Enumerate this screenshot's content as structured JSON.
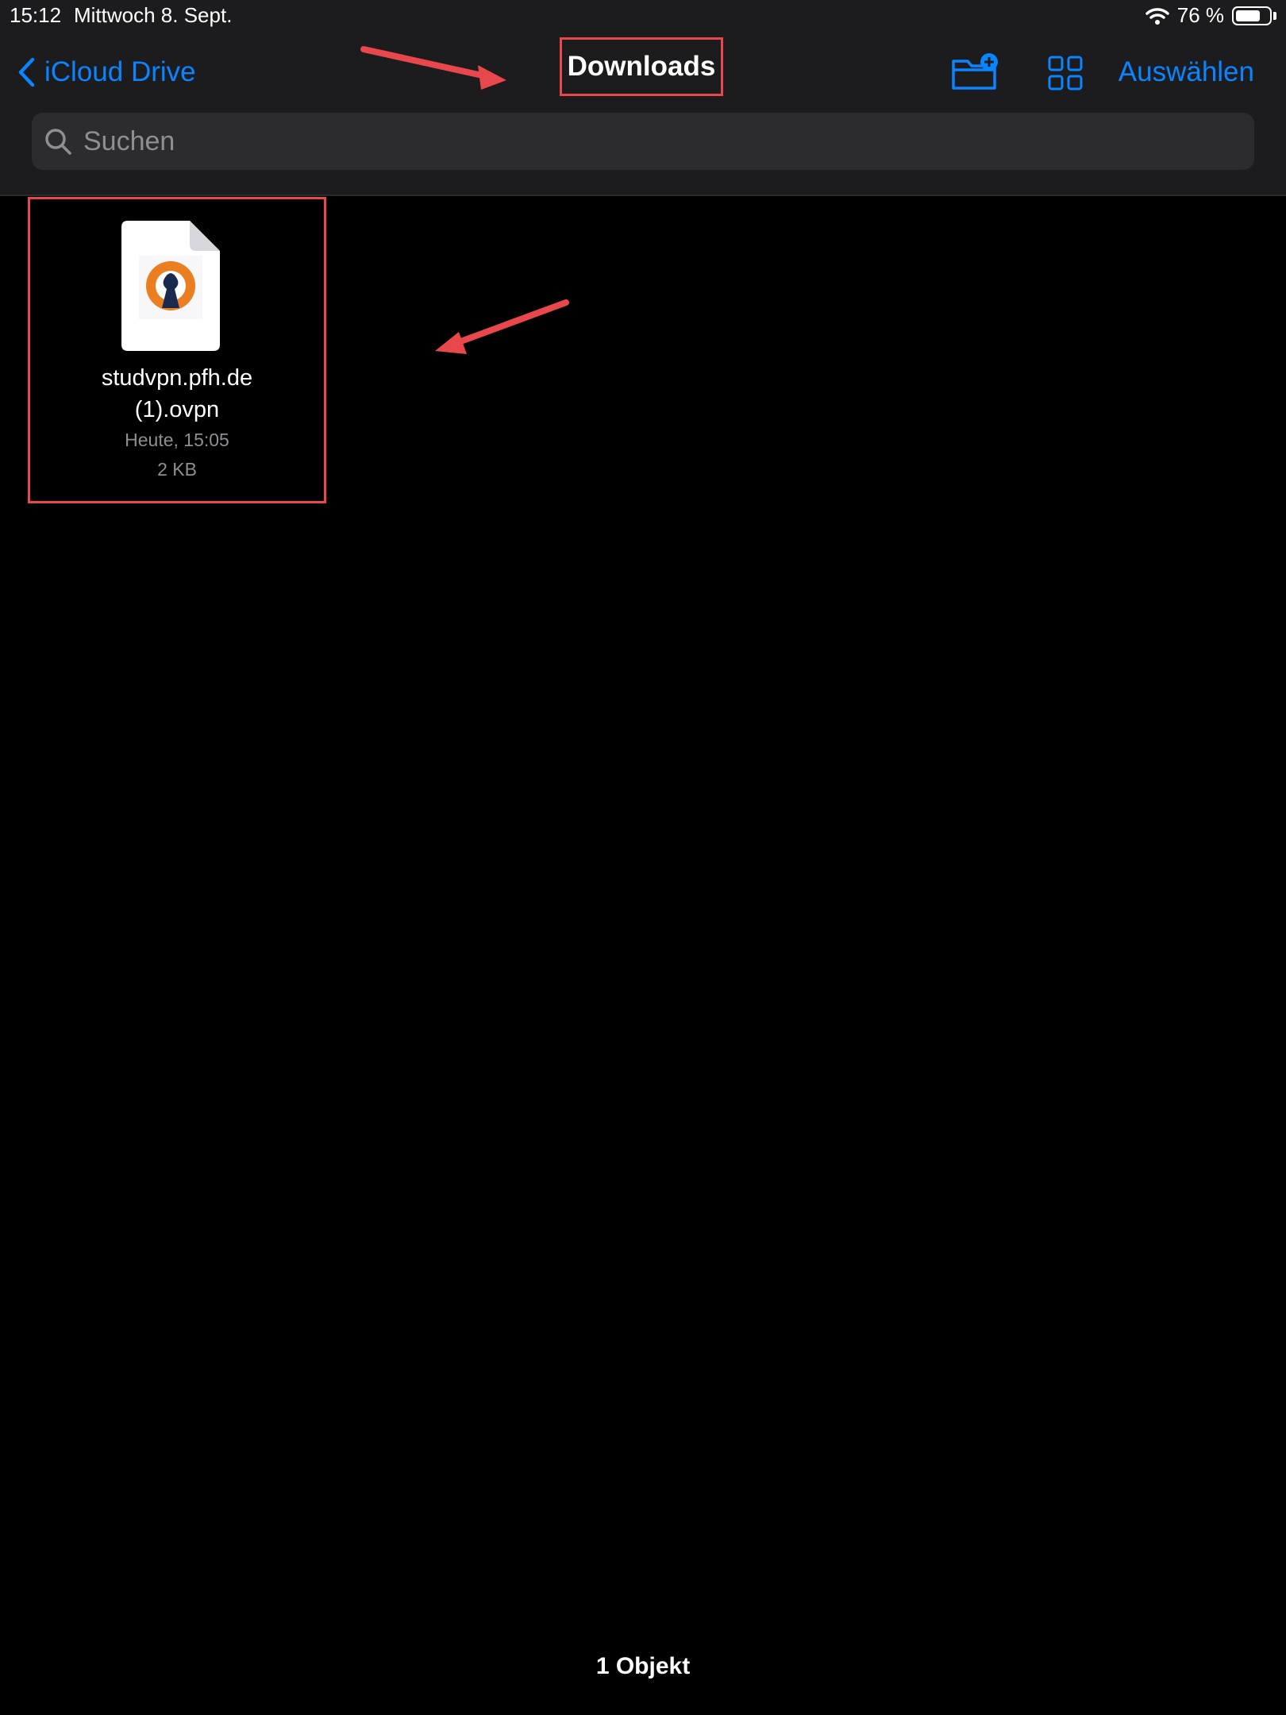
{
  "status_bar": {
    "time": "15:12",
    "date": "Mittwoch 8. Sept.",
    "battery_text": "76 %",
    "battery_level": 0.76
  },
  "nav": {
    "back_label": "iCloud Drive",
    "title": "Downloads",
    "select_label": "Auswählen"
  },
  "search": {
    "placeholder": "Suchen"
  },
  "files": [
    {
      "name_line1": "studvpn.pfh.de",
      "name_line2": "(1).ovpn",
      "date": "Heute, 15:05",
      "size": "2 KB",
      "icon": "openvpn-icon"
    }
  ],
  "footer": {
    "item_count": "1 Objekt"
  },
  "colors": {
    "accent": "#0a84ff",
    "annotation": "#e8484b",
    "openvpn_orange": "#ea7e20",
    "openvpn_navy": "#1a2a4f"
  }
}
